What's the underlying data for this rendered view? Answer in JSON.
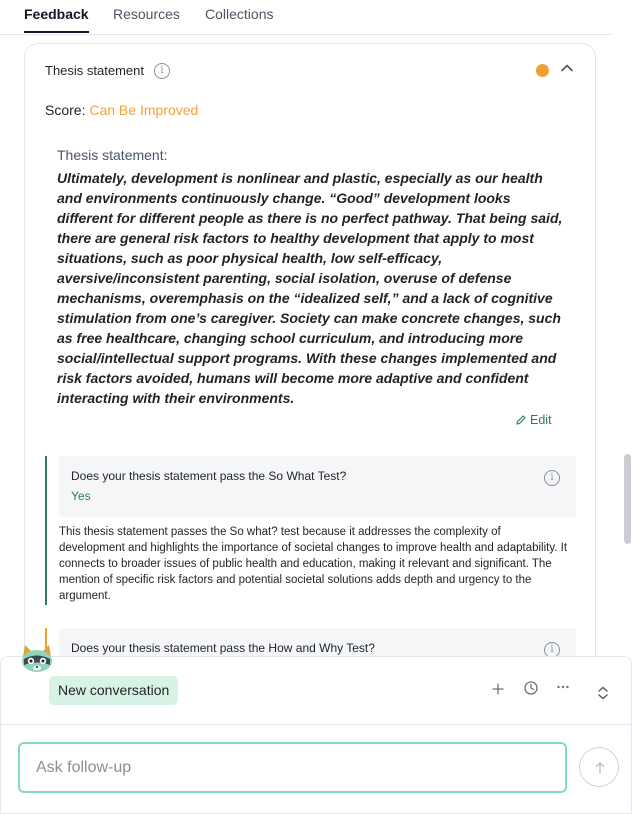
{
  "tabs": [
    {
      "label": "Feedback",
      "active": true
    },
    {
      "label": "Resources",
      "active": false
    },
    {
      "label": "Collections",
      "active": false
    }
  ],
  "card": {
    "title": "Thesis statement",
    "status_color": "#f0a033",
    "score_label": "Score:",
    "score_value": "Can Be Improved",
    "thesis_label": "Thesis statement:",
    "thesis_text": "Ultimately, development is nonlinear and plastic, especially as our health and environments continuously change. “Good” development looks different for different people as there is no perfect pathway. That being said, there are general risk factors to healthy development that apply to most situations, such as poor physical health, low self-efficacy, aversive/inconsistent parenting, social isolation, overuse of defense mechanisms, overemphasis on the “idealized self,” and a lack of cognitive stimulation from one’s caregiver. Society can make concrete changes, such as free healthcare, changing school curriculum, and introducing more social/intellectual support programs. With these changes implemented and risk factors avoided, humans will become more adaptive and confident interacting with their environments.",
    "edit_label": "Edit"
  },
  "questions": [
    {
      "title": "Does your thesis statement pass the So What Test?",
      "answer": "Yes",
      "bar_color": "#2e7d5b",
      "explanation": "This thesis statement passes the So what? test because it addresses the complexity of development and highlights the importance of societal changes to improve health and adaptability. It connects to broader issues of public health and education, making it relevant and significant. The mention of specific risk factors and potential societal solutions adds depth and urgency to the argument."
    },
    {
      "title": "Does your thesis statement pass the How and Why Test?",
      "bar_color": "#f0a033"
    }
  ],
  "chat": {
    "conversation_label": "New conversation",
    "input_placeholder": "Ask follow-up",
    "input_value": ""
  }
}
